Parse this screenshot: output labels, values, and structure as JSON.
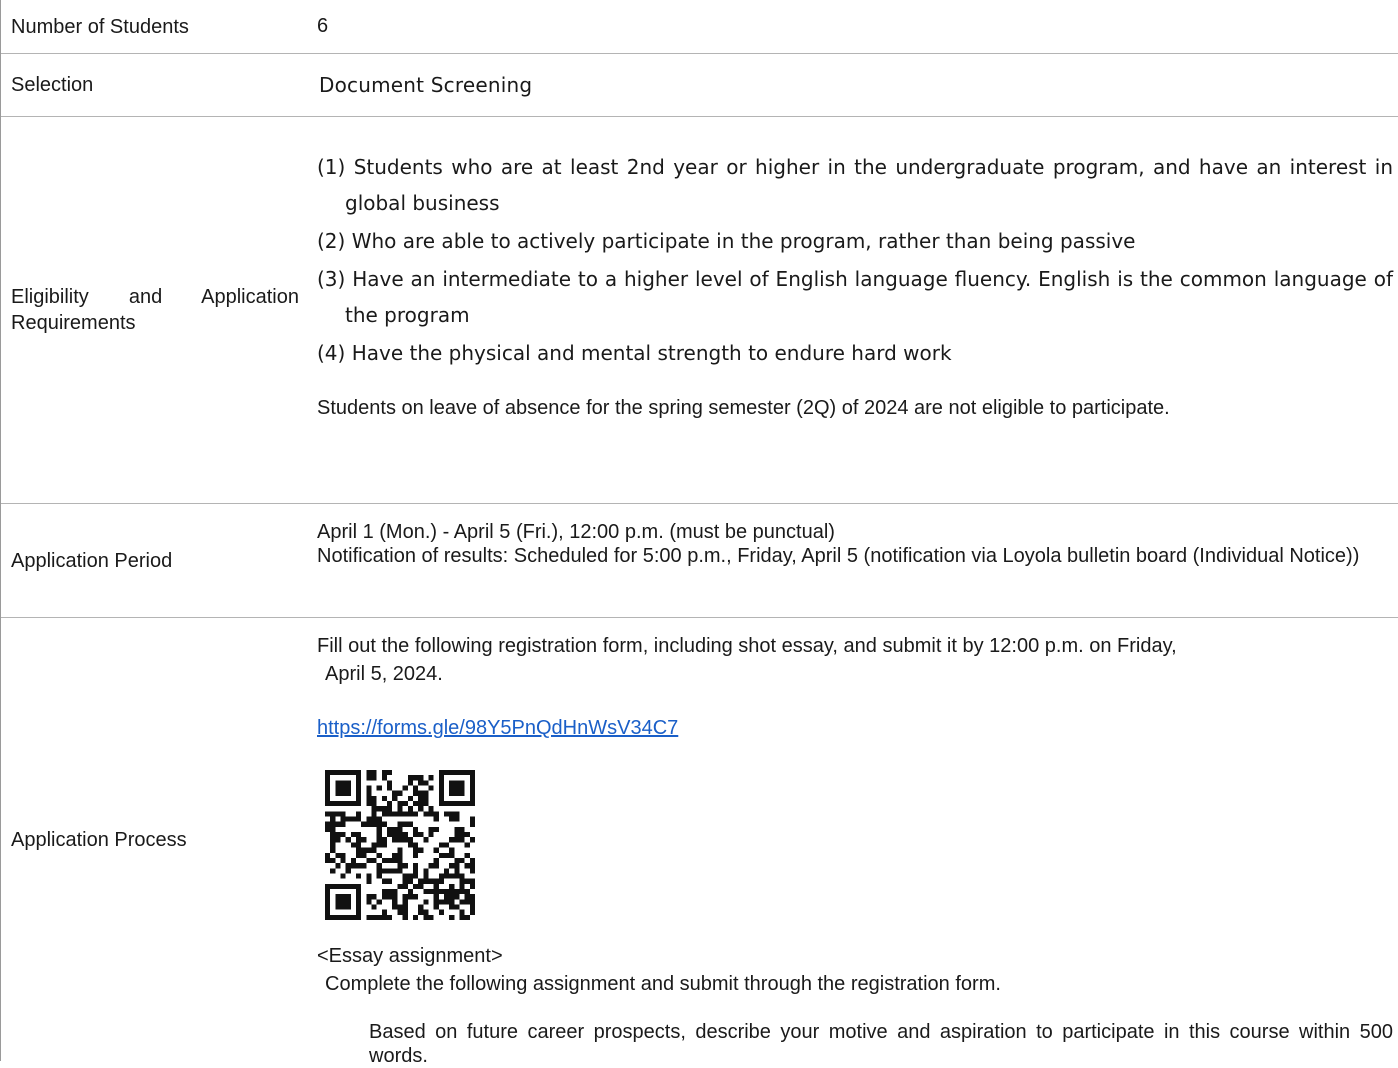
{
  "rows": {
    "students": {
      "label": "Number of Students",
      "value": "6"
    },
    "selection": {
      "label": "Selection",
      "value": "Document Screening"
    },
    "eligibility": {
      "label": "Eligibility and Application Requirements",
      "items": [
        "(1) Students who are at least 2nd year or higher in the undergraduate program, and have an interest in global business",
        "(2) Who are able to actively participate in the program, rather than being passive",
        "(3) Have an intermediate to a higher level of English language fluency.  English is the common language of the program",
        "(4) Have the physical and mental strength to endure hard work"
      ],
      "note": "Students on leave of absence for the spring semester (2Q) of 2024 are not eligible to participate."
    },
    "period": {
      "label": "Application Period",
      "line1": "April 1 (Mon.) - April 5 (Fri.), 12:00 p.m. (must be punctual)",
      "line2": "Notification of results: Scheduled for 5:00 p.m., Friday, April 5 (notification via Loyola bulletin board (Individual Notice))"
    },
    "process": {
      "label": "Application Process",
      "intro_line1": "Fill out the following registration form, including shot essay, and submit it by 12:00 p.m. on Friday,",
      "intro_line2": "April 5, 2024.",
      "link": "https://forms.gle/98Y5PnQdHnWsV34C7",
      "qr_icon": "qr-code-icon",
      "essay_heading": "<Essay assignment>",
      "essay_instruction": "Complete the following assignment and submit through the registration form.",
      "essay_prompt": "Based on future career prospects, describe your motive and aspiration to participate in this course within 500 words."
    }
  },
  "colors": {
    "link": "#1a5fc8",
    "border": "#b4b4b4",
    "text": "#1a1a1a"
  }
}
